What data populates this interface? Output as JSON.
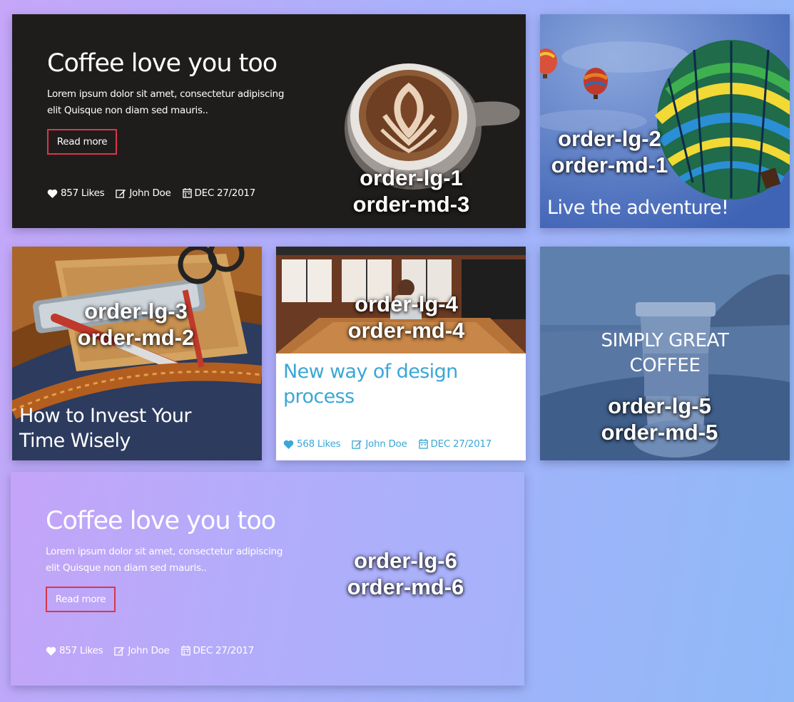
{
  "cards": [
    {
      "id": "card1",
      "title": "Coffee love you too",
      "text": "Lorem ipsum dolor sit amet, consectetur adipiscing elit Quisque non diam sed mauris..",
      "button": "Read more",
      "likes": "857 Likes",
      "author": "John Doe",
      "date": "DEC 27/2017",
      "order_lg": "order-lg-1",
      "order_md": "order-md-3"
    },
    {
      "id": "card2",
      "caption": "Live the adventure!",
      "order_lg": "order-lg-2",
      "order_md": "order-md-1"
    },
    {
      "id": "card3",
      "caption_line1": "How to Invest Your",
      "caption_line2": "Time Wisely",
      "order_lg": "order-lg-3",
      "order_md": "order-md-2"
    },
    {
      "id": "card4",
      "caption_line1": "New way of design",
      "caption_line2": "process",
      "likes": "568 Likes",
      "author": "John Doe",
      "date": "DEC 27/2017",
      "order_lg": "order-lg-4",
      "order_md": "order-md-4"
    },
    {
      "id": "card5",
      "caption_line1": "SIMPLY GREAT",
      "caption_line2": "COFFEE",
      "order_lg": "order-lg-5",
      "order_md": "order-md-5"
    },
    {
      "id": "card6",
      "title": "Coffee love you too",
      "text": "Lorem ipsum dolor sit amet, consectetur adipiscing elit Quisque non diam sed mauris..",
      "button": "Read more",
      "likes": "857 Likes",
      "author": "John Doe",
      "date": "DEC 27/2017",
      "order_lg": "order-lg-6",
      "order_md": "order-md-6"
    }
  ],
  "colors": {
    "accent_red": "#d8374a",
    "accent_blue": "#3aa7d6",
    "dark_card": "#1f1d1c"
  }
}
